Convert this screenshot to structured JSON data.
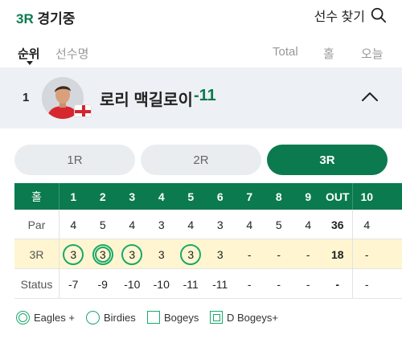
{
  "header": {
    "round_prefix": "3R",
    "round_status": " 경기중",
    "search_label": "선수 찾기",
    "search_icon": "search-icon"
  },
  "sort_bar": {
    "rank_label": "순위",
    "name_label": "선수명",
    "total_label": "Total",
    "hole_label": "홀",
    "today_label": "오늘"
  },
  "player": {
    "rank": "1",
    "name": "로리 맥길로이",
    "score": "-11",
    "flag": "northern-ireland-flag-icon"
  },
  "round_tabs": [
    "1R",
    "2R",
    "3R"
  ],
  "active_round": "3R",
  "scorecard": {
    "holes_label": "홀",
    "par_label": "Par",
    "round_label": "3R",
    "status_label": "Status",
    "holes": [
      "1",
      "2",
      "3",
      "4",
      "5",
      "6",
      "7",
      "8",
      "9",
      "OUT",
      "10"
    ],
    "par": [
      "4",
      "5",
      "4",
      "3",
      "4",
      "3",
      "4",
      "5",
      "4",
      "36",
      "4"
    ],
    "round_scores": [
      "3",
      "3",
      "3",
      "3",
      "3",
      "3",
      "-",
      "-",
      "-",
      "18",
      "-"
    ],
    "round_marks": [
      "birdie",
      "eagle",
      "birdie",
      "",
      "birdie",
      "",
      "",
      "",
      "",
      "",
      ""
    ],
    "status": [
      "-7",
      "-9",
      "-10",
      "-10",
      "-11",
      "-11",
      "-",
      "-",
      "-",
      "-",
      "-"
    ]
  },
  "legend": {
    "eagles": "Eagles +",
    "birdies": "Birdies",
    "bogeys": "Bogeys",
    "double_bogeys": "D Bogeys+"
  },
  "colors": {
    "brand_green": "#0b7a4e",
    "ring_green": "#1aa86c",
    "highlight_row": "#fff6d1",
    "player_row_bg": "#edf0f5"
  }
}
